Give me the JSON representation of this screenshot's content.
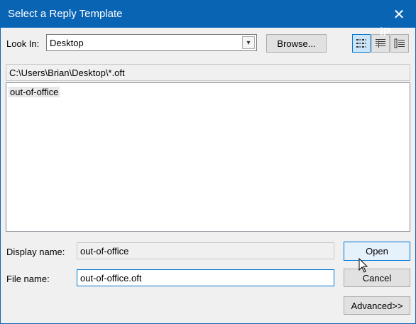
{
  "window": {
    "title": "Select a Reply Template",
    "close_glyph": "✕"
  },
  "look_in": {
    "label": "Look In:",
    "value": "Desktop",
    "browse_label": "Browse..."
  },
  "path": "C:\\Users\\Brian\\Desktop\\*.oft",
  "files": [
    {
      "name": "out-of-office"
    }
  ],
  "display_name": {
    "label": "Display name:",
    "value": "out-of-office"
  },
  "file_name": {
    "label": "File name:",
    "value": "out-of-office.oft"
  },
  "buttons": {
    "open": "Open",
    "cancel": "Cancel",
    "advanced": "Advanced>>"
  },
  "view_icons": [
    "list-view-icon",
    "details-view-icon",
    "properties-view-icon"
  ],
  "colors": {
    "titlebar": "#0a64b4",
    "accent": "#0078d7"
  }
}
